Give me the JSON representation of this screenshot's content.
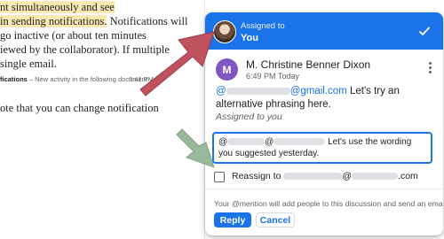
{
  "document": {
    "line1": "nt simultaneously and see",
    "line2": "in sending notifications.",
    "line2_rest": " Notifications will",
    "line3": "go inactive (or about ten minutes",
    "line4": "iewed by the collaborator). If multiple",
    "line5": "single email.",
    "notification_bold": "fications",
    "notification_rest": " – New activity in the following document …",
    "notification_time": "6:41 PM",
    "line6": "ote that you can change notification"
  },
  "assignment": {
    "caption": "Assigned to",
    "value": "You"
  },
  "comment": {
    "author_initial": "M",
    "author_name": "M. Christine Benner Dixon",
    "time": "6:49 PM Today",
    "mention_prefix": "@",
    "mention_domain": "@gmail.com",
    "text": " Let's try an alternative phrasing here.",
    "assigned_note": "Assigned to you"
  },
  "reply": {
    "prefix": "@",
    "at": "@",
    "text": " Let's use the wording you suggested yesterday."
  },
  "reassign": {
    "label": "Reassign to ",
    "at": "@",
    "suffix": ".com"
  },
  "footer": {
    "info": "Your @mention will add people to this discussion and send an email.",
    "reply_label": "Reply",
    "cancel_label": "Cancel"
  },
  "colors": {
    "accent": "#1a73e8",
    "highlight": "#fce8b2",
    "arrow_red": "#c0525f",
    "arrow_green": "#9ab89a"
  },
  "icons": [
    "check-icon",
    "more-vert-icon",
    "avatar"
  ]
}
